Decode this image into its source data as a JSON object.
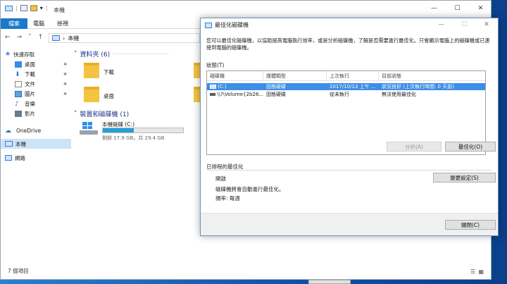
{
  "explorer": {
    "title": "本機",
    "ribbon_tabs": [
      "檔案",
      "電腦",
      "檢視"
    ],
    "address": "本機",
    "sidebar": [
      {
        "label": "快速存取",
        "icon": "star-icon",
        "pinned": false
      },
      {
        "label": "桌面",
        "icon": "desktop-icon",
        "pinned": true
      },
      {
        "label": "下載",
        "icon": "download-icon",
        "pinned": true
      },
      {
        "label": "文件",
        "icon": "document-icon",
        "pinned": true
      },
      {
        "label": "圖片",
        "icon": "pictures-icon",
        "pinned": true
      },
      {
        "label": "音樂",
        "icon": "music-icon",
        "pinned": false
      },
      {
        "label": "影片",
        "icon": "video-icon",
        "pinned": false
      },
      {
        "label": "OneDrive",
        "icon": "cloud-icon",
        "pinned": false
      },
      {
        "label": "本機",
        "icon": "computer-icon",
        "pinned": false,
        "selected": true
      },
      {
        "label": "網路",
        "icon": "network-icon",
        "pinned": false
      }
    ],
    "folders_group": "資料夾 (6)",
    "folders": [
      "下載",
      "桌面"
    ],
    "drives_group": "裝置和磁碟機 (1)",
    "drive": {
      "name": "本機磁碟 (C:)",
      "free_text": "剩餘 17.9 GB，共 29.4 GB",
      "used_fraction": 0.39
    },
    "status": "7 個項目"
  },
  "dialog": {
    "title": "最佳化磁碟機",
    "description": "您可以最佳化磁碟機，以協助提高電腦執行效率，或是分析磁碟機，了解是否需要進行最佳化。只會顯示電腦上的磁碟機或已連接到電腦的磁碟機。",
    "status_label": "狀態(T)",
    "columns": [
      "磁碟機",
      "媒體類型",
      "上次執行",
      "目前狀態"
    ],
    "rows": [
      {
        "drive": "(C:)",
        "media": "固態硬碟",
        "last_run": "2017/10/13 上午 ...",
        "state": "狀況良好 (上次執行時間: 0 天前)",
        "selected": true
      },
      {
        "drive": "\\\\?\\Volume{2b28...",
        "media": "固態硬碟",
        "last_run": "從未執行",
        "state": "無法使用最佳化",
        "selected": false
      }
    ],
    "analyze_button": "分析(A)",
    "optimize_button": "最佳化(O)",
    "scheduled_label": "已排程的最佳化",
    "schedule_state": "開啟",
    "schedule_desc": "磁碟機將會自動進行最佳化。",
    "frequency": "頻率: 每週",
    "change_settings_button": "變更設定(S)",
    "close_button": "關閉(C)"
  },
  "colors": {
    "accent": "#1979ca",
    "selection": "#3d8ee6"
  }
}
